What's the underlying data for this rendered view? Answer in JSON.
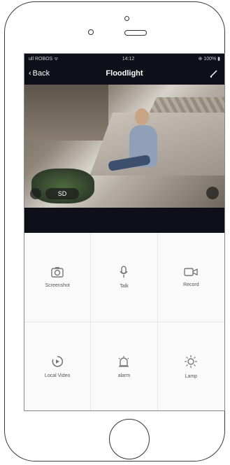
{
  "status": {
    "left": "ull ROBOS ᯤ",
    "time": "14:12",
    "right": "⊕ 100% ▮"
  },
  "nav": {
    "back": "Back",
    "title": "Floodlight"
  },
  "video": {
    "quality": "SD"
  },
  "controls": [
    {
      "label": "Screenshot"
    },
    {
      "label": "Talk"
    },
    {
      "label": "Record"
    },
    {
      "label": "Local Video"
    },
    {
      "label": "alarm"
    },
    {
      "label": "Lamp"
    }
  ]
}
